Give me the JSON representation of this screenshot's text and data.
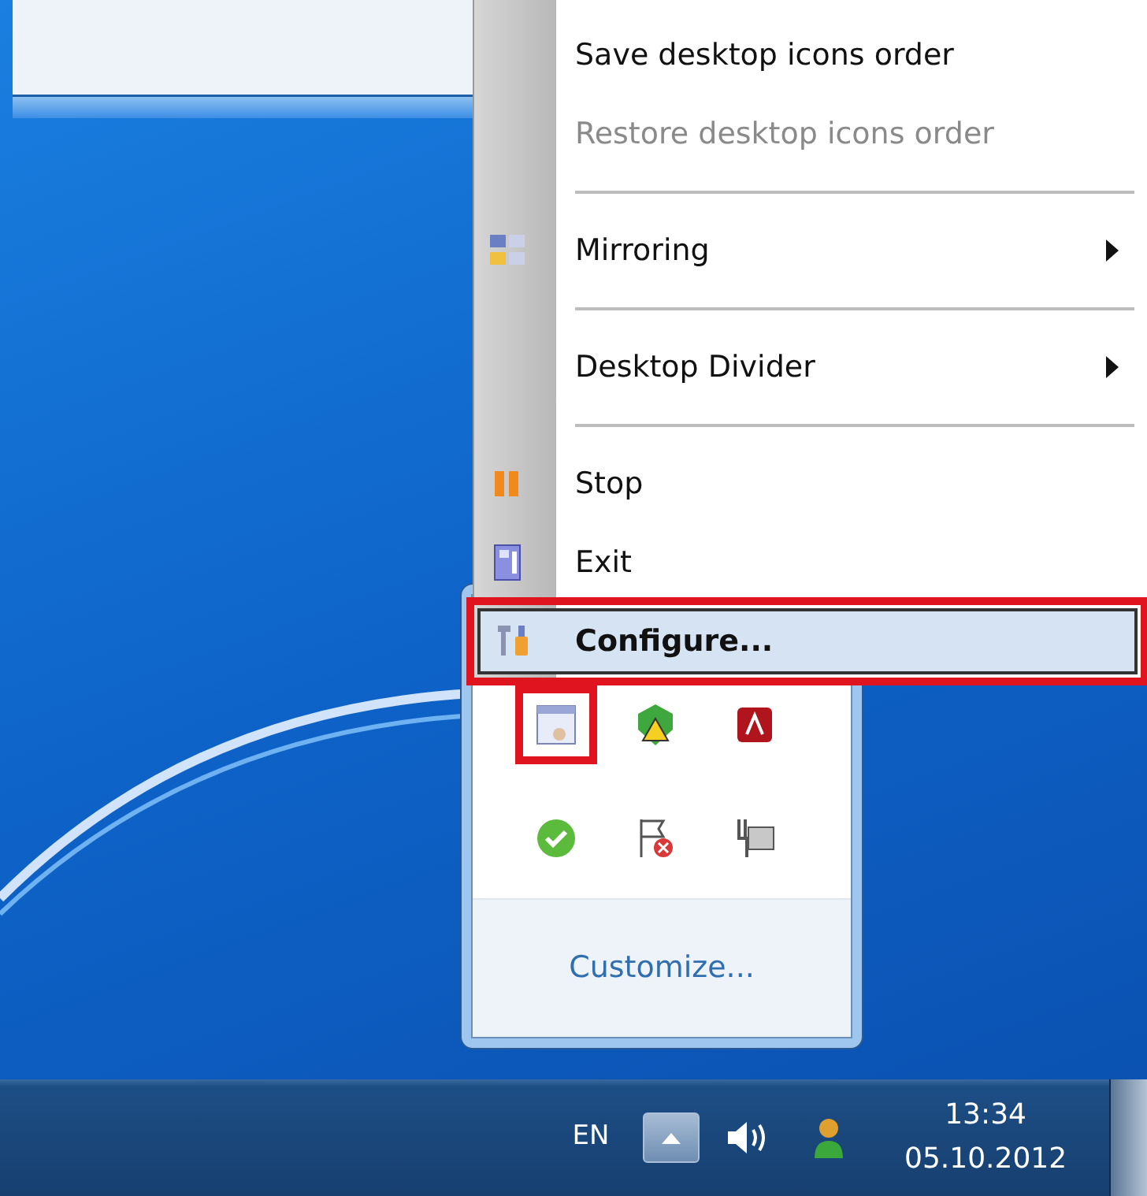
{
  "context_menu": {
    "items": [
      {
        "kind": "item",
        "label": "Save desktop icons order",
        "icon": false,
        "disabled": false,
        "submenu": false,
        "highlighted": false,
        "outlined": false
      },
      {
        "kind": "item",
        "label": "Restore desktop icons order",
        "icon": false,
        "disabled": true,
        "submenu": false,
        "highlighted": false,
        "outlined": false
      },
      {
        "kind": "separator"
      },
      {
        "kind": "item",
        "label": "Mirroring",
        "icon": true,
        "disabled": false,
        "submenu": true,
        "highlighted": false,
        "outlined": false
      },
      {
        "kind": "separator"
      },
      {
        "kind": "item",
        "label": "Desktop Divider",
        "icon": false,
        "disabled": false,
        "submenu": true,
        "highlighted": false,
        "outlined": false
      },
      {
        "kind": "separator"
      },
      {
        "kind": "item",
        "label": "Stop",
        "icon": true,
        "disabled": false,
        "submenu": false,
        "highlighted": false,
        "outlined": false
      },
      {
        "kind": "item",
        "label": "Exit",
        "icon": true,
        "disabled": false,
        "submenu": false,
        "highlighted": false,
        "outlined": false
      },
      {
        "kind": "item",
        "label": "Configure...",
        "icon": true,
        "disabled": false,
        "submenu": false,
        "highlighted": true,
        "outlined": true
      }
    ]
  },
  "tray_overflow": {
    "icons": [
      {
        "outlined": true
      },
      {
        "outlined": false
      },
      {
        "outlined": false
      },
      {
        "outlined": false
      },
      {
        "outlined": false
      },
      {
        "outlined": false
      }
    ],
    "link": "Customize..."
  },
  "taskbar": {
    "language": "EN",
    "time": "13:34",
    "date": "05.10.2012"
  }
}
